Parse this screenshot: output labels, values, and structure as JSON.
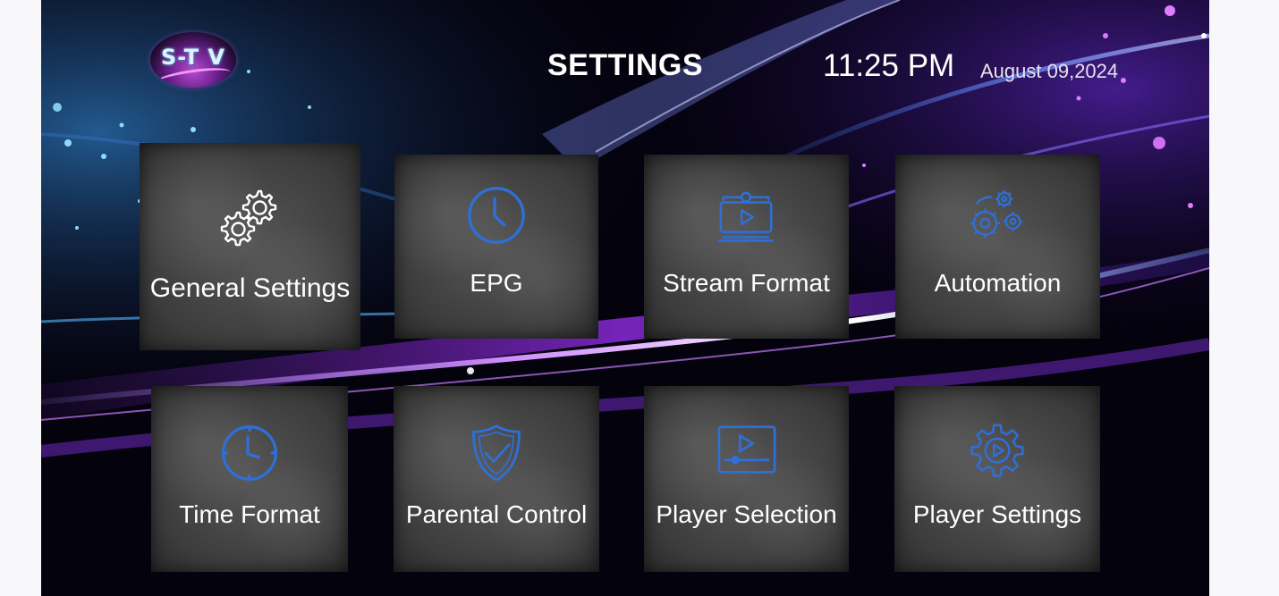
{
  "header": {
    "logo_text": "S-T V",
    "title": "SETTINGS",
    "time": "11:25 PM",
    "date": "August 09,2024"
  },
  "tiles": [
    {
      "label": "General Settings",
      "icon": "gears-icon"
    },
    {
      "label": "EPG",
      "icon": "clock-icon"
    },
    {
      "label": "Stream Format",
      "icon": "stream-monitor-icon"
    },
    {
      "label": "Automation",
      "icon": "automation-gears-icon"
    },
    {
      "label": "Time Format",
      "icon": "clock-icon"
    },
    {
      "label": "Parental Control",
      "icon": "shield-check-icon"
    },
    {
      "label": "Player Selection",
      "icon": "video-player-icon"
    },
    {
      "label": "Player Settings",
      "icon": "gear-play-icon"
    }
  ],
  "colors": {
    "icon_blue": "#2f6fd6",
    "icon_white": "#ffffff",
    "background": "#020108"
  }
}
